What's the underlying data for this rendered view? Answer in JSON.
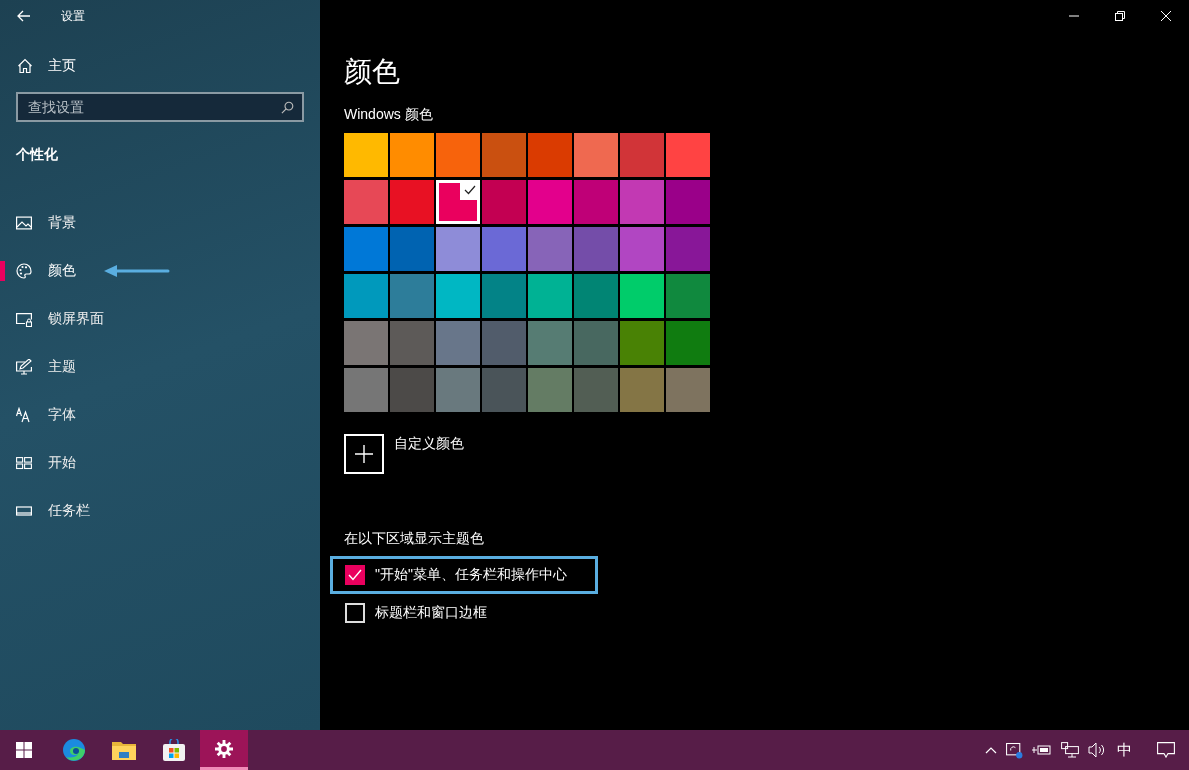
{
  "window": {
    "title": "设置"
  },
  "sidebar": {
    "home": "主页",
    "search": {
      "placeholder": "查找设置"
    },
    "section": "个性化",
    "items": [
      {
        "label": "背景",
        "kind": "picture",
        "selected": false,
        "pointer": false
      },
      {
        "label": "颜色",
        "kind": "palette",
        "selected": true,
        "pointer": true
      },
      {
        "label": "锁屏界面",
        "kind": "lockscreen",
        "selected": false,
        "pointer": false
      },
      {
        "label": "主题",
        "kind": "theme",
        "selected": false,
        "pointer": false
      },
      {
        "label": "字体",
        "kind": "font",
        "selected": false,
        "pointer": false
      },
      {
        "label": "开始",
        "kind": "start",
        "selected": false,
        "pointer": false
      },
      {
        "label": "任务栏",
        "kind": "taskbar",
        "selected": false,
        "pointer": false
      }
    ]
  },
  "main": {
    "title": "颜色",
    "windows_colors": {
      "label": "Windows 颜色",
      "swatches": [
        {
          "color": "#ffb900",
          "selected": false
        },
        {
          "color": "#ff8c00",
          "selected": false
        },
        {
          "color": "#f7630c",
          "selected": false
        },
        {
          "color": "#ca5010",
          "selected": false
        },
        {
          "color": "#da3b01",
          "selected": false
        },
        {
          "color": "#ef6950",
          "selected": false
        },
        {
          "color": "#d13438",
          "selected": false
        },
        {
          "color": "#ff4343",
          "selected": false
        },
        {
          "color": "#e74856",
          "selected": false
        },
        {
          "color": "#e81123",
          "selected": false
        },
        {
          "color": "#ea005e",
          "selected": true
        },
        {
          "color": "#c30052",
          "selected": false
        },
        {
          "color": "#e3008c",
          "selected": false
        },
        {
          "color": "#bf0077",
          "selected": false
        },
        {
          "color": "#c239b3",
          "selected": false
        },
        {
          "color": "#9a0089",
          "selected": false
        },
        {
          "color": "#0078d7",
          "selected": false
        },
        {
          "color": "#0063b1",
          "selected": false
        },
        {
          "color": "#8e8cd8",
          "selected": false
        },
        {
          "color": "#6b69d6",
          "selected": false
        },
        {
          "color": "#8764b8",
          "selected": false
        },
        {
          "color": "#744da9",
          "selected": false
        },
        {
          "color": "#b146c2",
          "selected": false
        },
        {
          "color": "#881798",
          "selected": false
        },
        {
          "color": "#0099bc",
          "selected": false
        },
        {
          "color": "#2d7d9a",
          "selected": false
        },
        {
          "color": "#00b7c3",
          "selected": false
        },
        {
          "color": "#038387",
          "selected": false
        },
        {
          "color": "#00b294",
          "selected": false
        },
        {
          "color": "#018574",
          "selected": false
        },
        {
          "color": "#00cc6a",
          "selected": false
        },
        {
          "color": "#10893e",
          "selected": false
        },
        {
          "color": "#7a7574",
          "selected": false
        },
        {
          "color": "#5d5a58",
          "selected": false
        },
        {
          "color": "#68768a",
          "selected": false
        },
        {
          "color": "#515c6b",
          "selected": false
        },
        {
          "color": "#567c73",
          "selected": false
        },
        {
          "color": "#486860",
          "selected": false
        },
        {
          "color": "#498205",
          "selected": false
        },
        {
          "color": "#107c10",
          "selected": false
        },
        {
          "color": "#767676",
          "selected": false
        },
        {
          "color": "#4c4a48",
          "selected": false
        },
        {
          "color": "#69797e",
          "selected": false
        },
        {
          "color": "#4a5459",
          "selected": false
        },
        {
          "color": "#647c64",
          "selected": false
        },
        {
          "color": "#525e54",
          "selected": false
        },
        {
          "color": "#847545",
          "selected": false
        },
        {
          "color": "#7e735f",
          "selected": false
        }
      ]
    },
    "custom_color": "自定义颜色",
    "accent_surfaces": {
      "label": "在以下区域显示主题色",
      "options": [
        {
          "label": "\"开始\"菜单、任务栏和操作中心",
          "checked": true,
          "highlighted": true
        },
        {
          "label": "标题栏和窗口边框",
          "checked": false,
          "highlighted": false
        }
      ]
    }
  },
  "taskbar": {
    "apps": [
      {
        "kind": "windows",
        "selected": false
      },
      {
        "kind": "edge",
        "selected": false
      },
      {
        "kind": "folder",
        "selected": false
      },
      {
        "kind": "store",
        "selected": false
      },
      {
        "kind": "gear",
        "selected": true
      }
    ],
    "ime": "中"
  }
}
